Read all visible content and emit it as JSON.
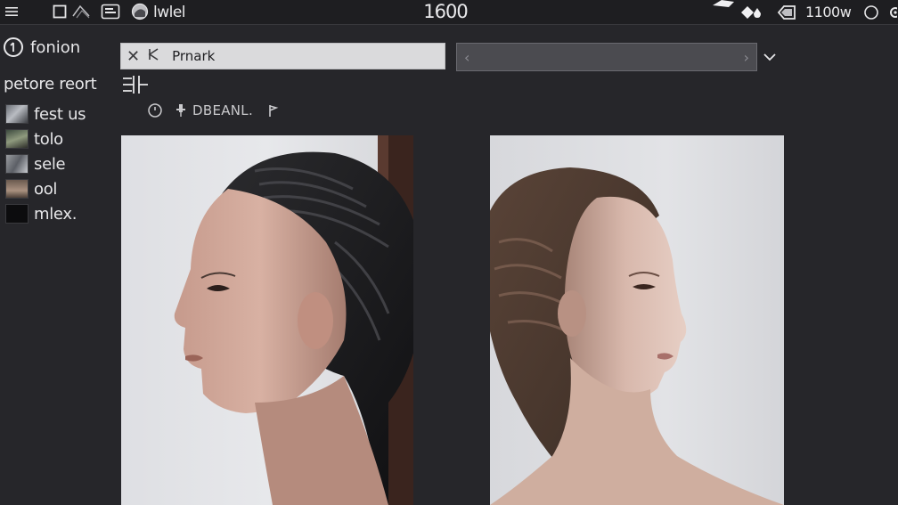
{
  "topbar": {
    "menu_icon": "hamburger-icon",
    "app_label": "lwlel",
    "center_value": "1600",
    "count_label": "1100w",
    "icons": [
      "square-icon",
      "layers-icon",
      "panel-icon",
      "globe-icon",
      "diamond-icon",
      "droplet-icon",
      "tag-icon",
      "circle-icon",
      "gear-icon"
    ]
  },
  "sidebar": {
    "header_label": "fonion",
    "header_icon": "circle-badge-icon",
    "subheader": "petore reort",
    "items": [
      {
        "label": "fest us",
        "thumb": "t1"
      },
      {
        "label": "tolo",
        "thumb": "t2"
      },
      {
        "label": "sele",
        "thumb": "t3"
      },
      {
        "label": "ool",
        "thumb": "t4"
      },
      {
        "label": "mlex.",
        "thumb": "t5"
      }
    ]
  },
  "search": {
    "value": "Prnark"
  },
  "select": {
    "value": "",
    "left_glyph": "‹",
    "right_glyph": "›"
  },
  "tools": {
    "label": "DBEANL."
  },
  "colors": {
    "background": "#26262a",
    "topbar": "#1e1e21",
    "search_bg": "#dadadc",
    "select_bg": "#4b4b50"
  }
}
